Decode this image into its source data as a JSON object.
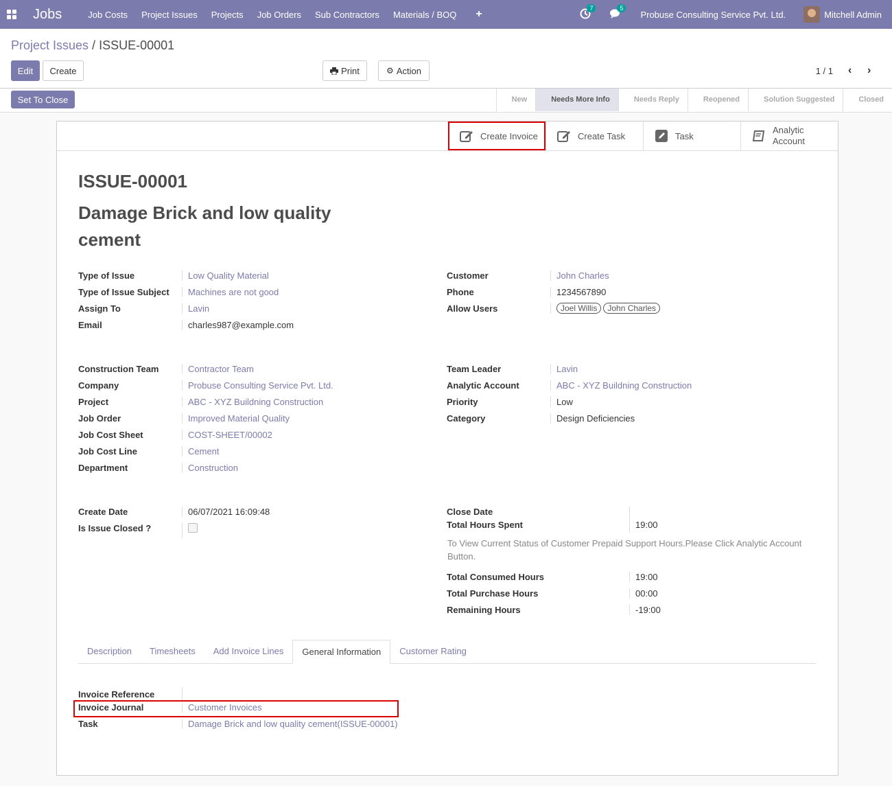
{
  "nav": {
    "brand": "Jobs",
    "menu": [
      "Job Costs",
      "Project Issues",
      "Projects",
      "Job Orders",
      "Sub Contractors",
      "Materials / BOQ"
    ],
    "plus": "+",
    "activity_count": "7",
    "messages_count": "5",
    "company": "Probuse Consulting Service Pvt. Ltd.",
    "user": "Mitchell Admin"
  },
  "breadcrumb": {
    "parent": "Project Issues",
    "sep": " / ",
    "current": "ISSUE-00001"
  },
  "buttons": {
    "edit": "Edit",
    "create": "Create",
    "print": "Print",
    "action": "Action",
    "set_to_close": "Set To Close"
  },
  "pager": {
    "value": "1 / 1"
  },
  "stages": [
    "New",
    "Needs More Info",
    "Needs Reply",
    "Reopened",
    "Solution Suggested",
    "Closed"
  ],
  "smart_buttons": {
    "create_invoice": "Create Invoice",
    "create_task": "Create Task",
    "task": "Task",
    "analytic_1": "Analytic",
    "analytic_2": "Account"
  },
  "record": {
    "code": "ISSUE-00001",
    "name": "Damage Brick and low quality cement"
  },
  "group1_left": [
    {
      "label": "Type of Issue",
      "value": "Low Quality Material",
      "link": true
    },
    {
      "label": "Type of Issue Subject",
      "value": "Machines are not good",
      "link": true
    },
    {
      "label": "Assign To",
      "value": "Lavin",
      "link": true
    },
    {
      "label": "Email",
      "value": "charles987@example.com",
      "link": false
    }
  ],
  "group1_right": {
    "customer_label": "Customer",
    "customer": "John Charles",
    "phone_label": "Phone",
    "phone": "1234567890",
    "users_label": "Allow Users",
    "users": [
      "Joel Willis",
      "John Charles"
    ]
  },
  "group2_left": [
    {
      "label": "Construction Team",
      "value": "Contractor Team",
      "link": true
    },
    {
      "label": "Company",
      "value": "Probuse Consulting Service Pvt. Ltd.",
      "link": true
    },
    {
      "label": "Project",
      "value": "ABC - XYZ Buildning Construction",
      "link": true
    },
    {
      "label": "Job Order",
      "value": "Improved Material Quality",
      "link": true
    },
    {
      "label": "Job Cost Sheet",
      "value": "COST-SHEET/00002",
      "link": true
    },
    {
      "label": "Job Cost Line",
      "value": "Cement",
      "link": true
    },
    {
      "label": "Department",
      "value": "Construction",
      "link": true
    }
  ],
  "group2_right": [
    {
      "label": "Team Leader",
      "value": "Lavin",
      "link": true
    },
    {
      "label": "Analytic Account",
      "value": "ABC - XYZ Buildning Construction",
      "link": true
    },
    {
      "label": "Priority",
      "value": "Low",
      "link": false
    },
    {
      "label": "Category",
      "value": "Design Deficiencies",
      "link": false
    }
  ],
  "group3_left": {
    "create_label": "Create Date",
    "create_value": "06/07/2021 16:09:48",
    "closed_label": "Is Issue Closed ?"
  },
  "group3_right": {
    "close_label": "Close Date",
    "hours_label": "Total Hours Spent",
    "hours_value": "19:00",
    "note": "To View Current Status of Customer Prepaid Support Hours.Please Click Analytic Account Button.",
    "consumed_label": "Total Consumed Hours",
    "consumed_value": "19:00",
    "purchase_label": "Total Purchase Hours",
    "purchase_value": "00:00",
    "remaining_label": "Remaining Hours",
    "remaining_value": "-19:00"
  },
  "tabs": [
    "Description",
    "Timesheets",
    "Add Invoice Lines",
    "General Information",
    "Customer Rating"
  ],
  "general": {
    "ref_label": "Invoice Reference",
    "journal_label": "Invoice Journal",
    "journal_value": "Customer Invoices",
    "task_label": "Task",
    "task_value": "Damage Brick and low quality cement(ISSUE-00001)"
  }
}
